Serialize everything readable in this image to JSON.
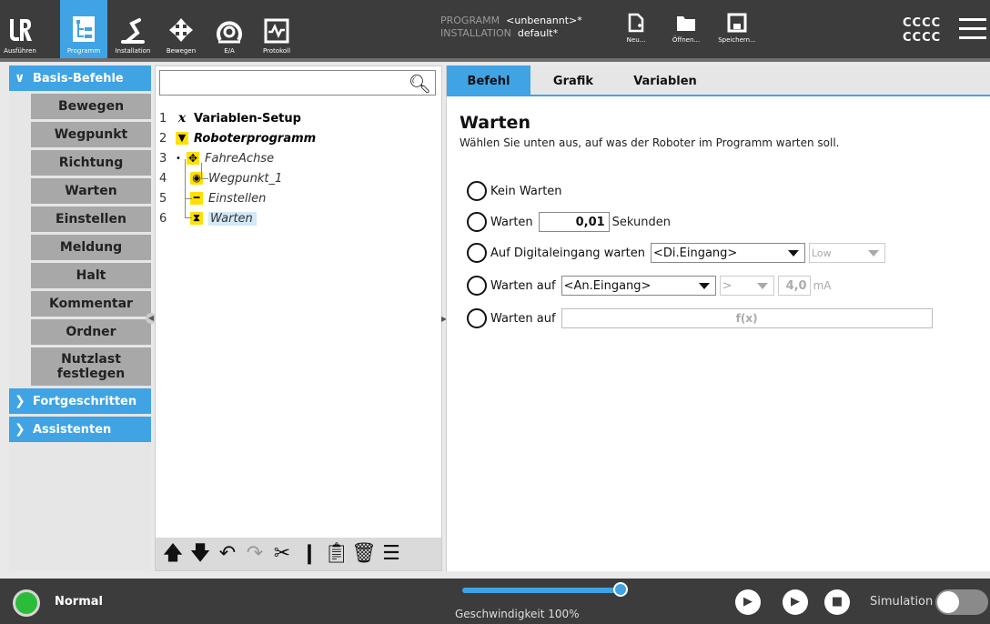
{
  "colors": {
    "accent": "#3fa3e4",
    "topbar": "#3c3c3c",
    "status_ok": "#2bbd3a",
    "tree_icon_yellow": "#ffe000"
  },
  "nav": [
    {
      "label": "Ausführen",
      "icon": "ur-logo-icon"
    },
    {
      "label": "Programm",
      "icon": "program-tree-icon",
      "active": true
    },
    {
      "label": "Installation",
      "icon": "robot-arm-icon"
    },
    {
      "label": "Bewegen",
      "icon": "move-arrows-icon"
    },
    {
      "label": "E/A",
      "icon": "io-gauge-icon"
    },
    {
      "label": "Protokoll",
      "icon": "log-chart-icon"
    }
  ],
  "program": {
    "program_key": "PROGRAMM",
    "program_value": "<unbenannt>*",
    "install_key": "INSTALLATION",
    "install_value": "default*"
  },
  "file_buttons": [
    {
      "label": "Neu...",
      "icon": "new-file-icon"
    },
    {
      "label": "Öffnen...",
      "icon": "folder-icon"
    },
    {
      "label": "Speichern...",
      "icon": "save-icon"
    }
  ],
  "user": {
    "line1": "CCCC",
    "line2": "CCCC"
  },
  "left_panel": {
    "basis": "Basis-Befehle",
    "commands": [
      "Bewegen",
      "Wegpunkt",
      "Richtung",
      "Warten",
      "Einstellen",
      "Meldung",
      "Halt",
      "Kommentar",
      "Ordner"
    ],
    "nutzlast_line1": "Nutzlast",
    "nutzlast_line2": "festlegen",
    "advanced": "Fortgeschritten",
    "wizards": "Assistenten"
  },
  "tree": {
    "search_placeholder": "",
    "rows": [
      {
        "num": "1",
        "label": "Variablen-Setup",
        "icon": "variable-icon"
      },
      {
        "num": "2",
        "label": "Roboterprogramm",
        "icon": "program-start-icon"
      },
      {
        "num": "3",
        "label": "FahreAchse",
        "icon": "move-icon"
      },
      {
        "num": "4",
        "label": "Wegpunkt_1",
        "icon": "waypoint-icon"
      },
      {
        "num": "5",
        "label": "Einstellen",
        "icon": "set-icon"
      },
      {
        "num": "6",
        "label": "Warten",
        "icon": "hourglass-icon"
      }
    ],
    "toolbar_icons": [
      "move-up-icon",
      "move-down-icon",
      "undo-icon",
      "redo-icon",
      "cut-icon",
      "copy-icon",
      "paste-icon",
      "delete-icon",
      "suppress-icon"
    ]
  },
  "tabs": [
    "Befehl",
    "Grafik",
    "Variablen"
  ],
  "command": {
    "title": "Warten",
    "subtitle": "Wählen Sie unten aus, auf was der Roboter im Programm warten soll.",
    "opt_none": "Kein Warten",
    "opt_time": "Warten",
    "time_value": "0,01",
    "time_unit": "Sekunden",
    "opt_digital": "Auf Digitaleingang warten",
    "digital_input": "<Di.Eingang>",
    "digital_level": "Low",
    "opt_analog": "Warten auf",
    "analog_input": "<An.Eingang>",
    "analog_op": ">",
    "analog_value": "4,0",
    "analog_unit": "mA",
    "opt_expr": "Warten auf",
    "expr_label": "f(x)"
  },
  "footer": {
    "status": "Normal",
    "speed": "Geschwindigkeit 100%",
    "speed_fraction": 1.0,
    "simulation": "Simulation"
  }
}
